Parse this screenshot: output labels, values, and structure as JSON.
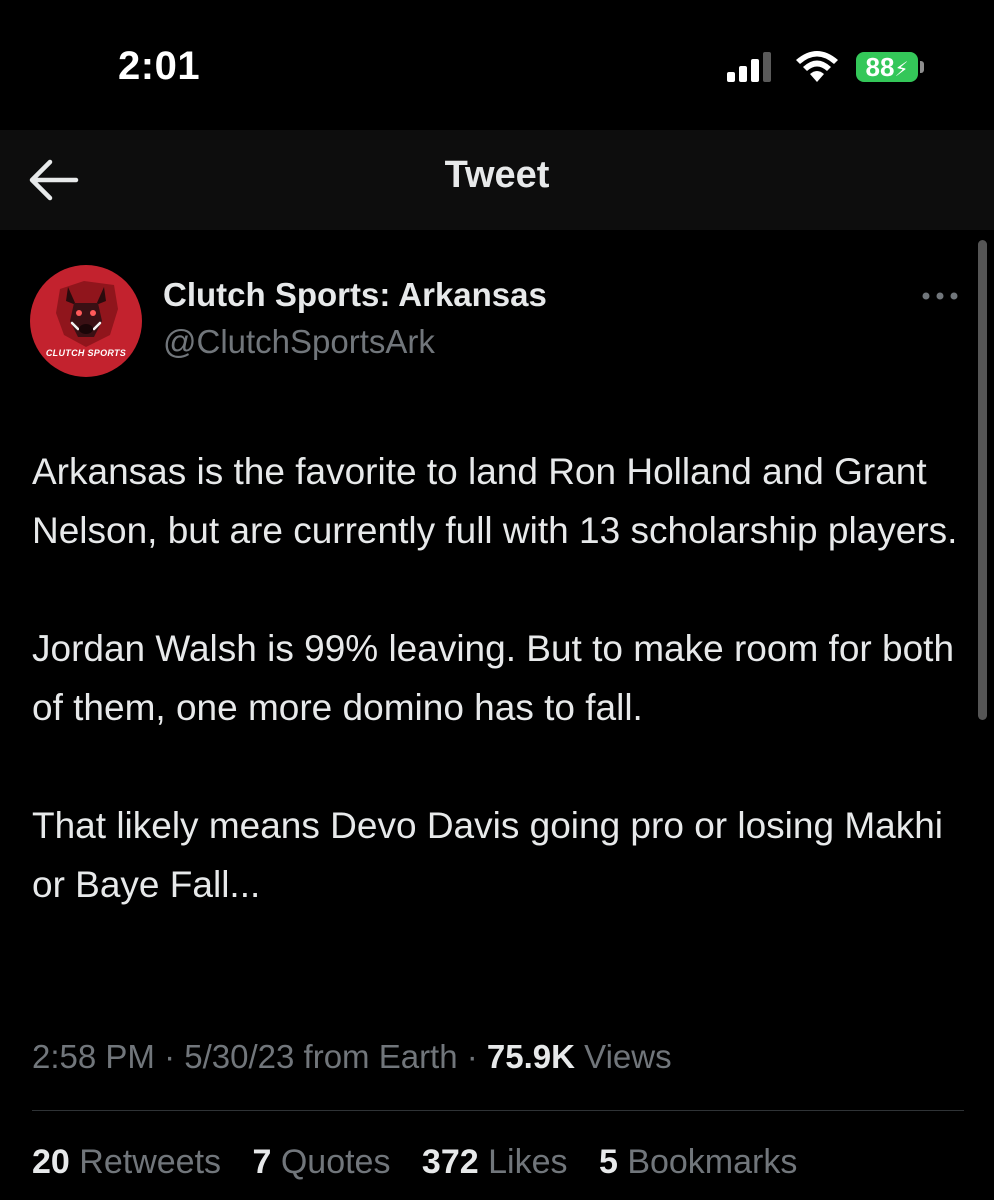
{
  "status_bar": {
    "time": "2:01",
    "battery": "88",
    "colors": {
      "battery": "#34c759"
    }
  },
  "header": {
    "title": "Tweet",
    "back_icon": "arrow-left-icon"
  },
  "tweet": {
    "avatar_caption": "CLUTCH SPORTS",
    "display_name": "Clutch Sports: Arkansas",
    "handle": "@ClutchSportsArk",
    "more_icon": "more-horizontal-icon",
    "paragraphs": [
      "Arkansas is the favorite to land Ron Holland and Grant Nelson, but are currently full with 13 scholarship players.",
      "Jordan Walsh is 99% leaving. But to make room for both of them, one more domino has to fall.",
      "That likely means Devo Davis going pro or losing Makhi or Baye Fall..."
    ],
    "meta": {
      "time": "2:58 PM",
      "date": "5/30/23",
      "source": "from Earth",
      "views_count": "75.9K",
      "views_label": "Views"
    },
    "stats": [
      {
        "count": "20",
        "label": "Retweets"
      },
      {
        "count": "7",
        "label": "Quotes"
      },
      {
        "count": "372",
        "label": "Likes"
      },
      {
        "count": "5",
        "label": "Bookmarks"
      }
    ]
  },
  "colors": {
    "background": "#000000",
    "text_primary": "#e7e9ea",
    "text_secondary": "#71767b",
    "avatar_bg": "#c3222e"
  }
}
